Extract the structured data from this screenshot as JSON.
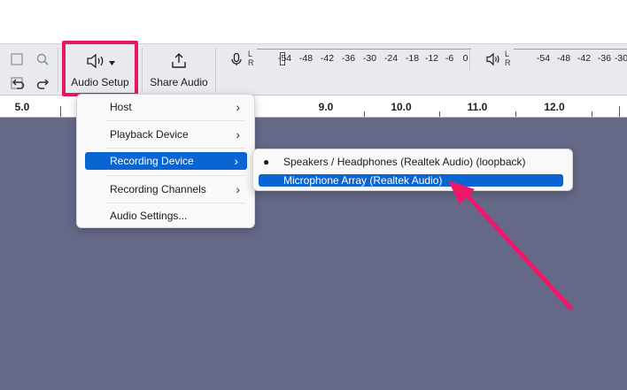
{
  "toolbar": {
    "audio_setup_label": "Audio Setup",
    "share_audio_label": "Share Audio",
    "highlight_color": "#e5195e"
  },
  "record_meter": {
    "channels": [
      "L",
      "R"
    ],
    "ticks": [
      "-54",
      "-48",
      "-42",
      "-36",
      "-30",
      "-24",
      "-18",
      "-12",
      "-6",
      "0"
    ]
  },
  "play_meter": {
    "channels": [
      "L",
      "R"
    ],
    "ticks": [
      "-54",
      "-48",
      "-42",
      "-36",
      "-30"
    ]
  },
  "ruler": {
    "labels": [
      "5.0",
      "9.0",
      "10.0",
      "11.0",
      "12.0"
    ]
  },
  "audio_setup_menu": {
    "items": [
      "Host",
      "Playback Device",
      "Recording Device",
      "Recording Channels",
      "Audio Settings..."
    ]
  },
  "recording_device_submenu": {
    "items": [
      "Speakers / Headphones (Realtek Audio) (loopback)",
      "Microphone Array (Realtek Audio)"
    ]
  },
  "colors": {
    "selection": "#0a64d2",
    "track_background": "#656887",
    "annotation_arrow": "#f0176a"
  }
}
